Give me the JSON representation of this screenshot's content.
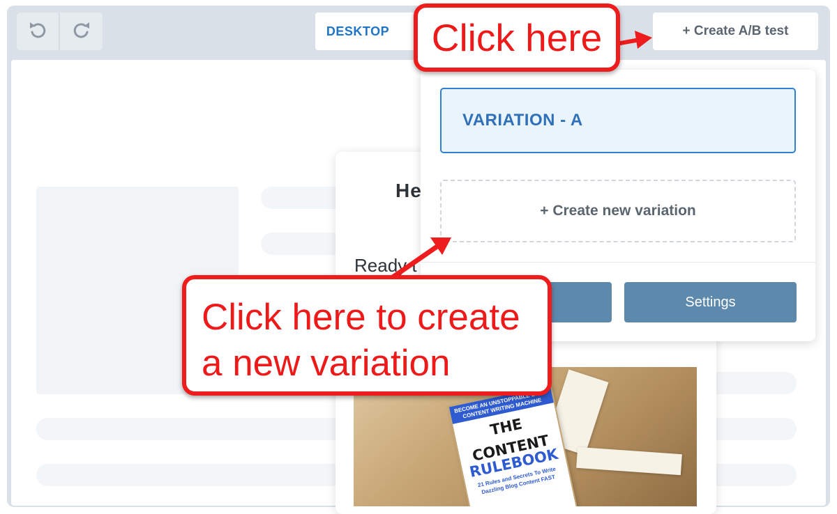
{
  "toolbar": {
    "undo_icon": "undo-icon",
    "redo_icon": "redo-icon",
    "device_label": "DESKTOP",
    "create_ab_label": "+ Create A/B test"
  },
  "preview": {
    "heading_partial": "He",
    "text_partial": "Ready t",
    "book": {
      "band_text": "BECOME AN UNSTOPPABLE BLOG CONTENT WRITING MACHINE",
      "title_line1": "THE",
      "title_line2": "CONTENT",
      "title_line3": "RULEBOOK",
      "subtitle": "21 Rules and Secrets To Write Dazzling Blog Content FAST"
    }
  },
  "dropdown": {
    "variation_a": "VARIATION - A",
    "create_variation": "+ Create new variation",
    "settings_label": "Settings"
  },
  "annotations": {
    "callout_top": "Click here",
    "callout_bottom_line1": "Click here to create",
    "callout_bottom_line2": "a new variation",
    "accent_color": "#ee1c1c"
  }
}
